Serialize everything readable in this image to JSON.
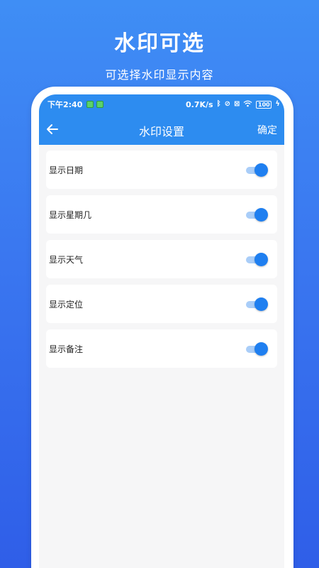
{
  "promo": {
    "title": "水印可选",
    "subtitle": "可选择水印显示内容"
  },
  "status_bar": {
    "time": "下午2:40",
    "speed": "0.7K/s",
    "battery": "100"
  },
  "toolbar": {
    "title": "水印设置",
    "confirm_label": "确定"
  },
  "settings": [
    {
      "label": "显示日期",
      "enabled": true
    },
    {
      "label": "显示星期几",
      "enabled": true
    },
    {
      "label": "显示天气",
      "enabled": true
    },
    {
      "label": "显示定位",
      "enabled": true
    },
    {
      "label": "显示备注",
      "enabled": true
    }
  ],
  "colors": {
    "accent": "#2d8cf0",
    "toggle_on": "#1f7ff0",
    "toggle_track": "#a9cdf8"
  },
  "icons": {
    "back": "arrow-left-icon",
    "bluetooth": "bluetooth-icon",
    "wifi": "wifi-icon",
    "battery": "battery-icon"
  }
}
